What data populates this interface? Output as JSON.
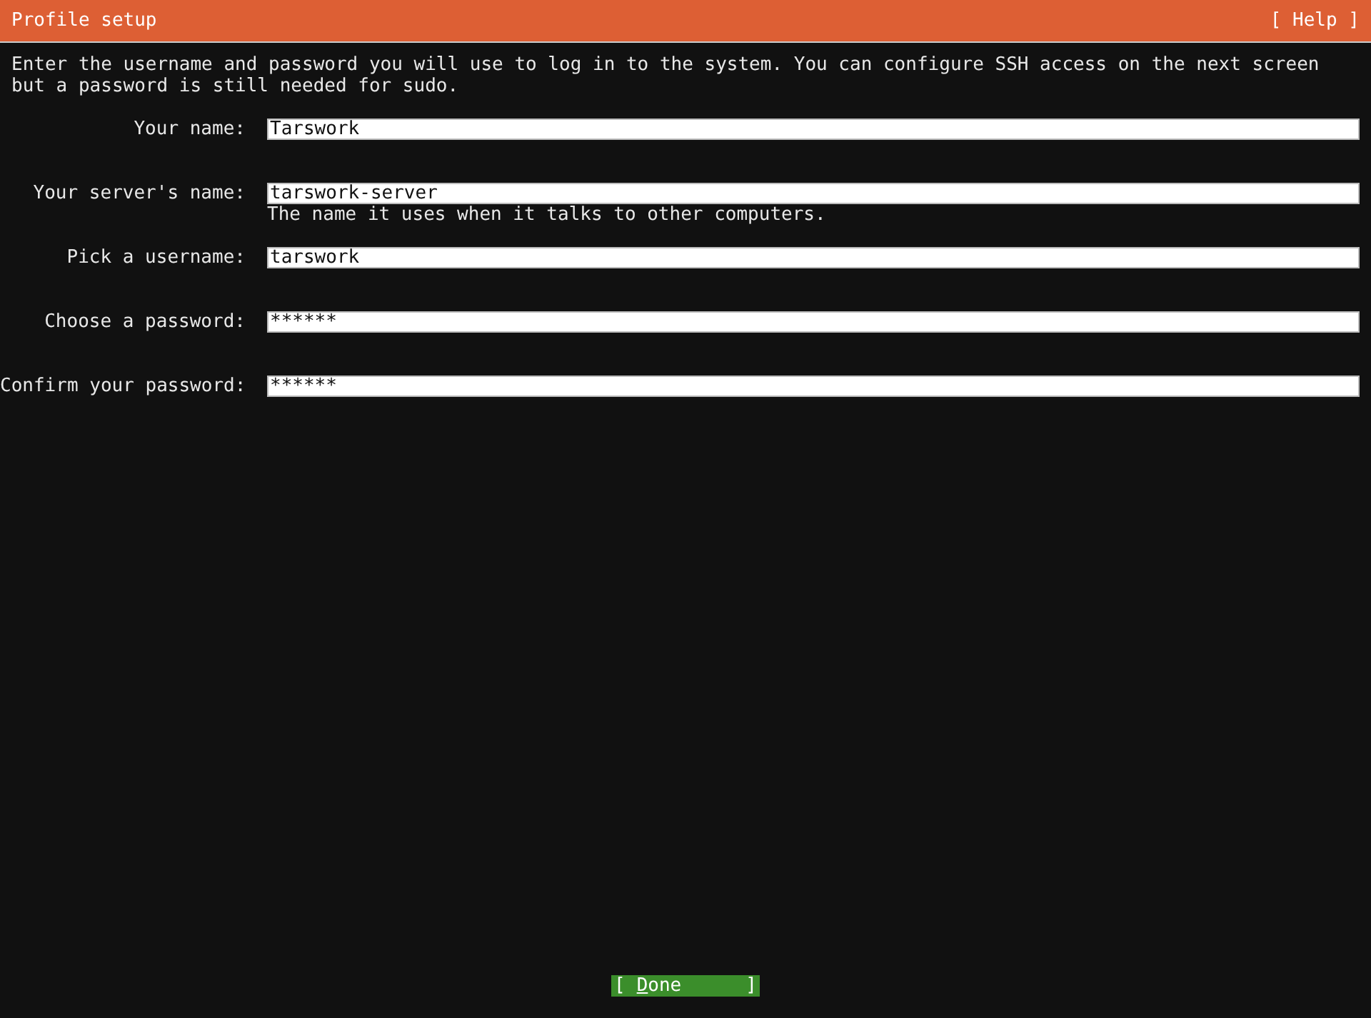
{
  "header": {
    "title": "Profile setup",
    "help": "[ Help ]"
  },
  "intro": "Enter the username and password you will use to log in to the system. You can configure SSH access on the next screen but a password is still needed for sudo.",
  "fields": [
    {
      "label": "Your name:",
      "value": "Tarswork"
    },
    {
      "label": "Your server's name:",
      "value": "tarswork-server",
      "hint": "The name it uses when it talks to other computers."
    },
    {
      "label": "Pick a username:",
      "value": "tarswork"
    },
    {
      "label": "Choose a password:",
      "value": "******"
    },
    {
      "label": "Confirm your password:",
      "value": "******"
    }
  ],
  "done_button": {
    "open": "[",
    "label": "Done",
    "close": "]"
  }
}
